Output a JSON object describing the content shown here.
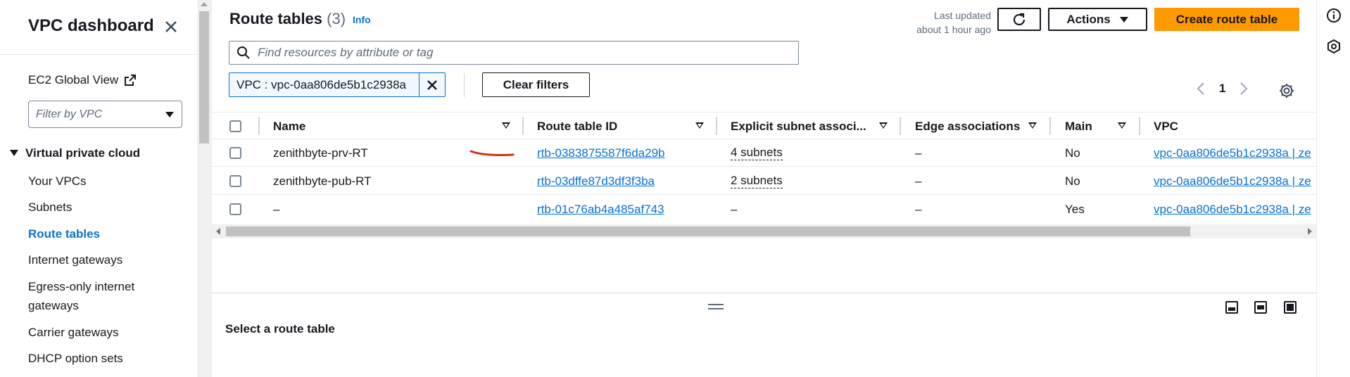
{
  "sidebar": {
    "title": "VPC dashboard",
    "ec2_global_view": "EC2 Global View",
    "filter_placeholder": "Filter by VPC",
    "section": "Virtual private cloud",
    "items": [
      {
        "label": "Your VPCs",
        "active": false
      },
      {
        "label": "Subnets",
        "active": false
      },
      {
        "label": "Route tables",
        "active": true
      },
      {
        "label": "Internet gateways",
        "active": false
      },
      {
        "label": "Egress-only internet",
        "active": false
      },
      {
        "label": "gateways",
        "active": false
      },
      {
        "label": "Carrier gateways",
        "active": false
      },
      {
        "label": "DHCP option sets",
        "active": false
      }
    ]
  },
  "header": {
    "title": "Route tables",
    "count": "(3)",
    "info": "Info",
    "last_updated_line1": "Last updated",
    "last_updated_line2": "about 1 hour ago",
    "actions_label": "Actions",
    "create_label": "Create route table"
  },
  "search": {
    "placeholder": "Find resources by attribute or tag"
  },
  "filter_token": {
    "label": "VPC : vpc-0aa806de5b1c2938a"
  },
  "clear_filters_label": "Clear filters",
  "pagination": {
    "current_page": "1"
  },
  "table": {
    "columns": [
      "Name",
      "Route table ID",
      "Explicit subnet associ...",
      "Edge associations",
      "Main",
      "VPC"
    ],
    "rows": [
      {
        "name": "zenithbyte-prv-RT",
        "id": "rtb-0383875587f6da29b",
        "subnets": "4 subnets",
        "edge": "–",
        "main": "No",
        "vpc": "vpc-0aa806de5b1c2938a | ze"
      },
      {
        "name": "zenithbyte-pub-RT",
        "id": "rtb-03dffe87d3df3f3ba",
        "subnets": "2 subnets",
        "edge": "–",
        "main": "No",
        "vpc": "vpc-0aa806de5b1c2938a | ze"
      },
      {
        "name": "–",
        "id": "rtb-01c76ab4a485af743",
        "subnets": "–",
        "edge": "–",
        "main": "Yes",
        "vpc": "vpc-0aa806de5b1c2938a | ze"
      }
    ]
  },
  "details": {
    "empty_label": "Select a route table"
  },
  "colors": {
    "accent": "#0972d3",
    "primary_button": "#ff9900",
    "annotation": "#d13212"
  },
  "icons": [
    "close-icon",
    "external-link-icon",
    "caret-down-icon",
    "refresh-icon",
    "search-icon",
    "settings-icon",
    "info-icon",
    "hexagon-icon"
  ]
}
